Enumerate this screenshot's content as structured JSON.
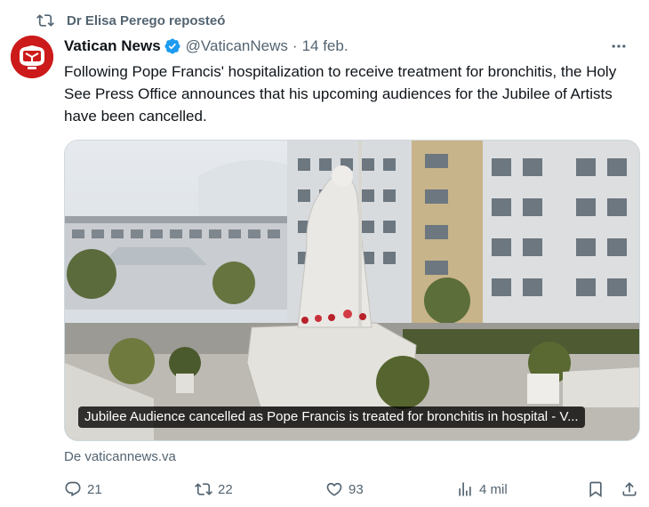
{
  "repost": {
    "text": "Dr Elisa Perego reposteó",
    "icon": "repost-icon"
  },
  "author": {
    "name": "Vatican News",
    "handle": "@VaticanNews",
    "separator": "·",
    "date": "14 feb.",
    "verified": true,
    "avatar_icon": "vatican-news-logo",
    "avatar_color": "#cc1a1a",
    "verified_color": "#1d9bf0"
  },
  "tweet": {
    "text": "Following Pope Francis' hospitalization to receive treatment for bronchitis, the Holy See Press Office announces that his upcoming audiences for the Jubilee of Artists have been cancelled."
  },
  "card": {
    "caption": "Jubilee Audience cancelled as Pope Francis is treated for bronchitis in hospital - V...",
    "image_subject": "statue of Pope John Paul II in front of Gemelli hospital"
  },
  "source": {
    "text": "De vaticannews.va"
  },
  "actions": {
    "replies": "21",
    "reposts": "22",
    "likes": "93",
    "views": "4 mil"
  }
}
